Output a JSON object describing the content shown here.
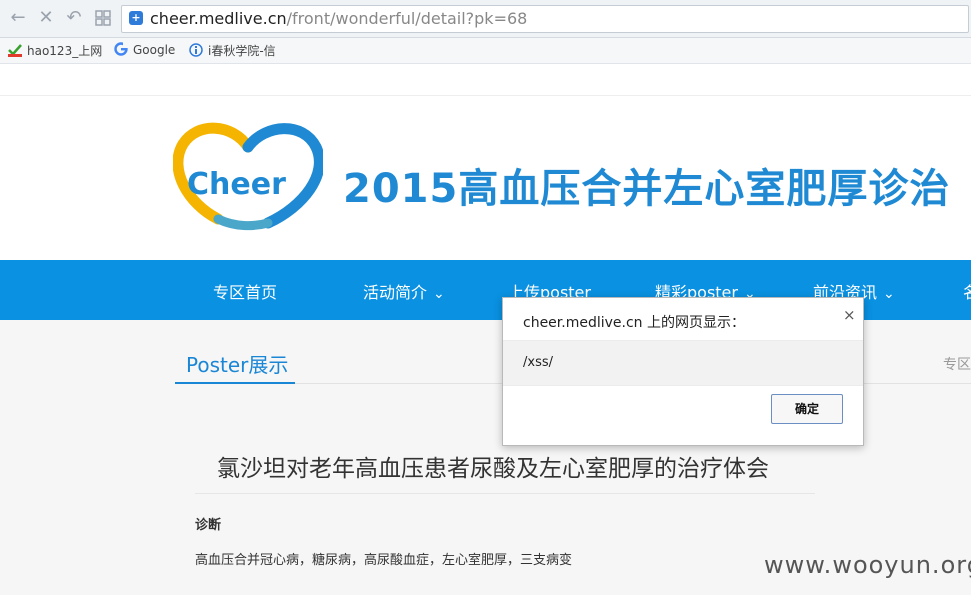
{
  "browser": {
    "url_host": "cheer.medlive.cn",
    "url_path": "/front/wonderful/detail?pk=68",
    "bookmarks": [
      "hao123_上网",
      "Google",
      "i春秋学院-信"
    ],
    "icons": {
      "back": "back-arrow-icon",
      "stop": "close-icon",
      "reload": "undo-icon",
      "grid": "grid-icon",
      "security": "shield-icon"
    }
  },
  "site": {
    "logo_text": "Cheer",
    "title": "2015高血压合并左心室肥厚诊治",
    "nav": [
      "专区首页",
      "活动简介",
      "上传poster",
      "精彩poster",
      "前沿资讯",
      "名"
    ],
    "brand_color": "#0a91e2"
  },
  "tabs": {
    "active": "Poster展示",
    "breadcrumb": "专区"
  },
  "article": {
    "title": "氯沙坦对老年高血压患者尿酸及左心室肥厚的治疗体会",
    "section_heading": "诊断",
    "section_body": "高血压合并冠心病，糖尿病，高尿酸血症，左心室肥厚，三支病变"
  },
  "dialog": {
    "title": "cheer.medlive.cn 上的网页显示：",
    "message": "/xss/",
    "ok_label": "确定",
    "close_glyph": "×"
  },
  "watermark": "www.wooyun.org"
}
